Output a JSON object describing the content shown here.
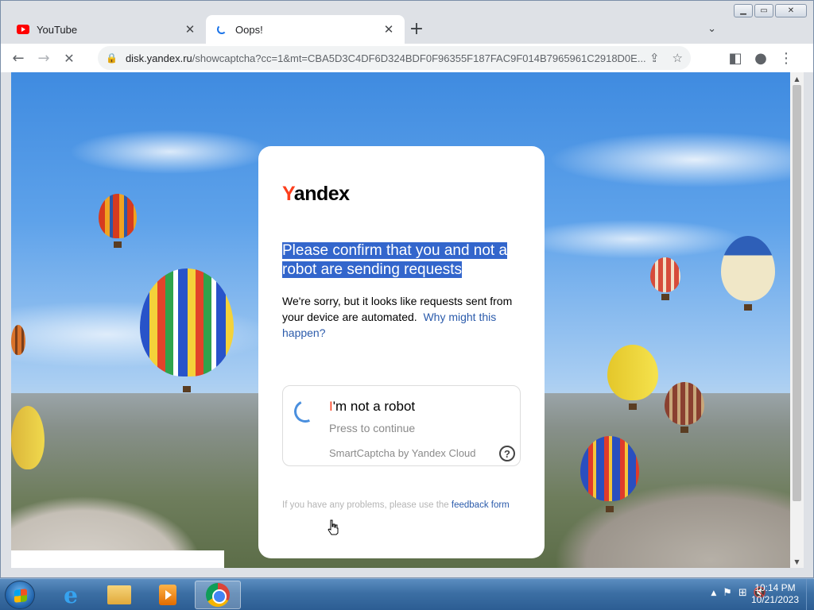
{
  "window": {
    "controls": {
      "minimize": "▁",
      "maximize": "▭",
      "close": "✕"
    }
  },
  "tabs": [
    {
      "title": "YouTube",
      "icon": "youtube-icon",
      "close": "✕"
    },
    {
      "title": "Oops!",
      "icon": "loading-icon",
      "close": "✕",
      "active": true
    }
  ],
  "new_tab": "+",
  "tab_search": "⌄",
  "toolbar": {
    "back": "←",
    "forward": "→",
    "reload": "✕",
    "url_host": "disk.yandex.ru",
    "url_path": "/showcaptcha?cc=1&mt=CBA5D3C4DF6D324BDF0F96355F187FAC9F014B7965961C2918D0E...",
    "share": "⇪",
    "bookmark": "☆",
    "sidepanel": "◧",
    "profile": "●",
    "menu": "⋮"
  },
  "captcha": {
    "logo_first": "Y",
    "logo_rest": "andex",
    "headline": "Please confirm that you and not a robot are sending requests",
    "body": "We're sorry, but it looks like requests sent from your device are automated.",
    "why_link": "Why might this happen?",
    "check_title_first": "I",
    "check_title_rest": "'m not a robot",
    "check_sub": "Press to continue",
    "brand": "SmartCaptcha by Yandex Cloud",
    "help": "?",
    "problems_text": "If you have any problems, please use the",
    "feedback_link": "feedback form"
  },
  "taskbar": {
    "clock_time": "10:14 PM",
    "clock_date": "10/21/2023",
    "tray_arrow": "▲",
    "tray_icons": [
      "⚑",
      "⊞",
      "🔇"
    ],
    "ie_label": "e"
  },
  "colors": {
    "yandex_red": "#fc3f1d",
    "selection": "#3366cc",
    "link": "#2b5bab"
  }
}
